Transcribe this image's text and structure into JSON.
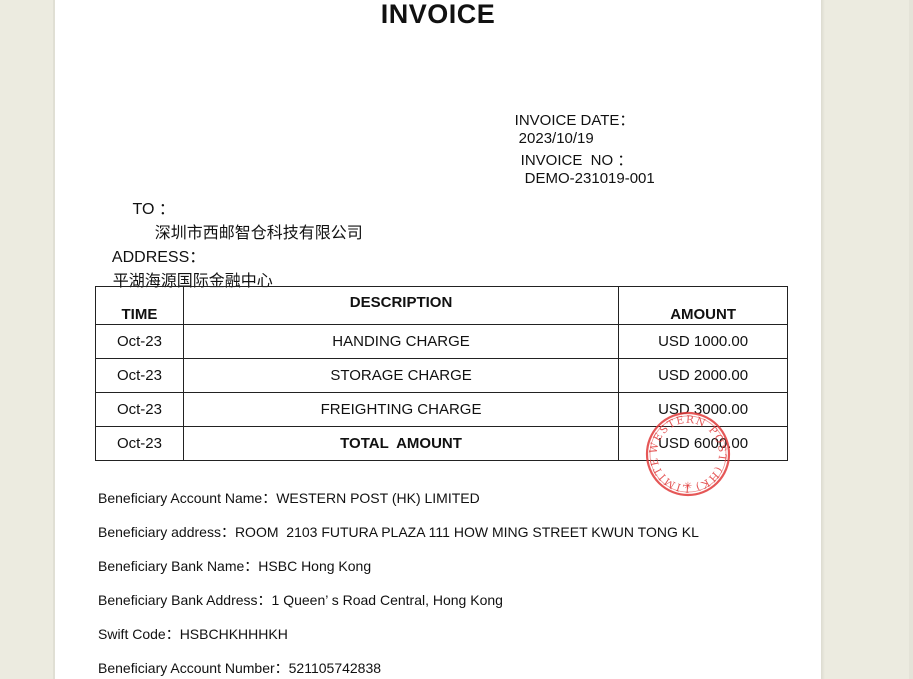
{
  "invoice": {
    "title": "INVOICE",
    "date_label": "INVOICE DATE：",
    "date_value": "2023/10/19",
    "number_label": "INVOICE  NO ：",
    "number_value": "DEMO-231019-001"
  },
  "recipient": {
    "to_label": "TO ：",
    "to_value": "深圳市西邮智仓科技有限公司",
    "address_label": "ADDRESS：",
    "address_value": "平湖海源国际金融中心"
  },
  "table": {
    "headers": {
      "time": "TIME",
      "description": "DESCRIPTION",
      "amount": "AMOUNT"
    },
    "rows": [
      {
        "time": "Oct-23",
        "description": "HANDING CHARGE",
        "amount": "USD 1000.00"
      },
      {
        "time": "Oct-23",
        "description": "STORAGE CHARGE",
        "amount": "USD 2000.00"
      },
      {
        "time": "Oct-23",
        "description": "FREIGHTING CHARGE",
        "amount": "USD 3000.00"
      }
    ],
    "total": {
      "time": "Oct-23",
      "label": "TOTAL  AMOUNT",
      "amount": "USD 6000.00"
    }
  },
  "bank": {
    "account_name": "Beneficiary Account Name：WESTERN POST (HK) LIMITED",
    "address": "Beneficiary address：ROOM  2103 FUTURA PLAZA 111 HOW MING STREET KWUN TONG KL",
    "bank_name": "Beneficiary Bank Name：HSBC Hong Kong",
    "bank_address": "Beneficiary Bank Address：1 Queen’ s Road Central, Hong Kong",
    "swift": "Swift Code：HSBCHKHHHKH",
    "account_number": "Beneficiary Account Number：521105742838"
  },
  "stamp": {
    "text": "WESTERN POST (HK) LIMITED",
    "color": "#e03a3a"
  }
}
